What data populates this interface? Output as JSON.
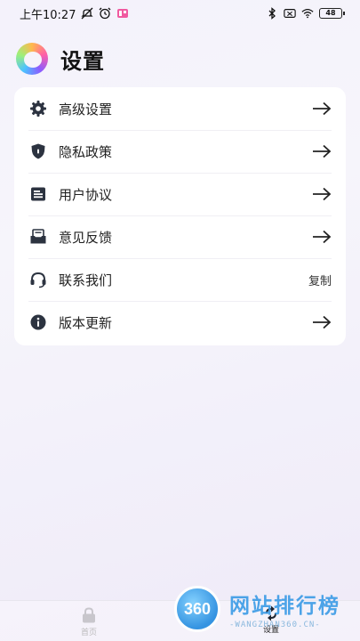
{
  "status_bar": {
    "time": "上午10:27",
    "battery": "48",
    "icons": [
      "silent-icon",
      "alarm-icon",
      "app-notification-icon",
      "bluetooth-icon",
      "sim-icon",
      "wifi-icon",
      "battery-icon"
    ]
  },
  "header": {
    "title": "设置",
    "logo_icon": "app-logo-icon"
  },
  "menu": {
    "items": [
      {
        "label": "高级设置",
        "icon": "gear-icon",
        "action": "arrow-right-icon"
      },
      {
        "label": "隐私政策",
        "icon": "shield-icon",
        "action": "arrow-right-icon"
      },
      {
        "label": "用户协议",
        "icon": "document-icon",
        "action": "arrow-right-icon"
      },
      {
        "label": "意见反馈",
        "icon": "inbox-icon",
        "action": "arrow-right-icon"
      },
      {
        "label": "联系我们",
        "icon": "headset-icon",
        "action_label": "复制"
      },
      {
        "label": "版本更新",
        "icon": "info-icon",
        "action": "arrow-right-icon"
      }
    ]
  },
  "bottom_nav": {
    "home_label": "首页",
    "settings_label": "设置"
  },
  "watermark": {
    "badge": "360",
    "title": "网站排行榜",
    "subtitle": "-WANGZHAN360.CN-"
  },
  "colors": {
    "card_bg": "#ffffff",
    "icon_dark": "#2c3340",
    "watermark_blue": "#3a9be6"
  }
}
